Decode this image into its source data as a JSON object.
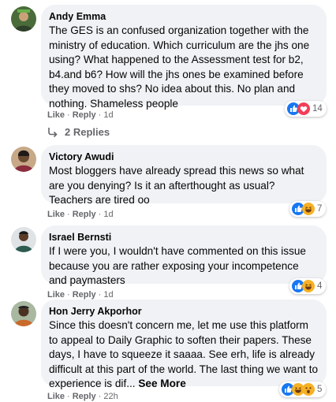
{
  "comments": [
    {
      "author": "Andy Emma",
      "text": "The GES is an confused organization together with the ministry of education. Which curriculum are the jhs one using? What happened to the Assessment test for b2, b4.and b6? How will the jhs ones be examined before they moved to shs? No idea about this. No plan and nothing. Shameless people",
      "like_label": "Like",
      "reply_label": "Reply",
      "time": "1d",
      "reaction_count": "14",
      "reaction_icons": [
        "like-icon",
        "love-icon"
      ],
      "avatar_icon": "user-avatar-icon"
    },
    {
      "author": "Victory Awudi",
      "text": "Most bloggers have already spread this news so what are you denying? Is it an afterthought as usual? Teachers are tired oo",
      "like_label": "Like",
      "reply_label": "Reply",
      "time": "1d",
      "reaction_count": "7",
      "reaction_icons": [
        "like-icon",
        "haha-icon"
      ],
      "avatar_icon": "user-avatar-icon"
    },
    {
      "author": "Israel Bernsti",
      "text": "If I were you, I wouldn't have commented on this issue because you are rather exposing your incompetence and paymasters",
      "like_label": "Like",
      "reply_label": "Reply",
      "time": "1d",
      "reaction_count": "4",
      "reaction_icons": [
        "like-icon",
        "haha-icon"
      ],
      "avatar_icon": "user-avatar-icon"
    },
    {
      "author": "Hon Jerry Akporhor",
      "text": "Since this doesn't concern me, let me use this platform to appeal to Daily Graphic to soften their papers. These days, I have to squeeze it saaaa. See erh, life is already difficult at this part of the world. The last thing we want to experience is dif...",
      "see_more": "See More",
      "like_label": "Like",
      "reply_label": "Reply",
      "time": "22h",
      "reaction_count": "5",
      "reaction_icons": [
        "like-icon",
        "haha-icon",
        "wow-icon"
      ],
      "avatar_icon": "user-avatar-icon"
    }
  ],
  "replies": {
    "label": "2 Replies",
    "icon": "reply-arrow-icon"
  },
  "colors": {
    "like": "#1877f2",
    "love": "#f33e58",
    "haha": "#f7b125",
    "bubble": "#f0f2f5",
    "meta": "#65676b"
  }
}
